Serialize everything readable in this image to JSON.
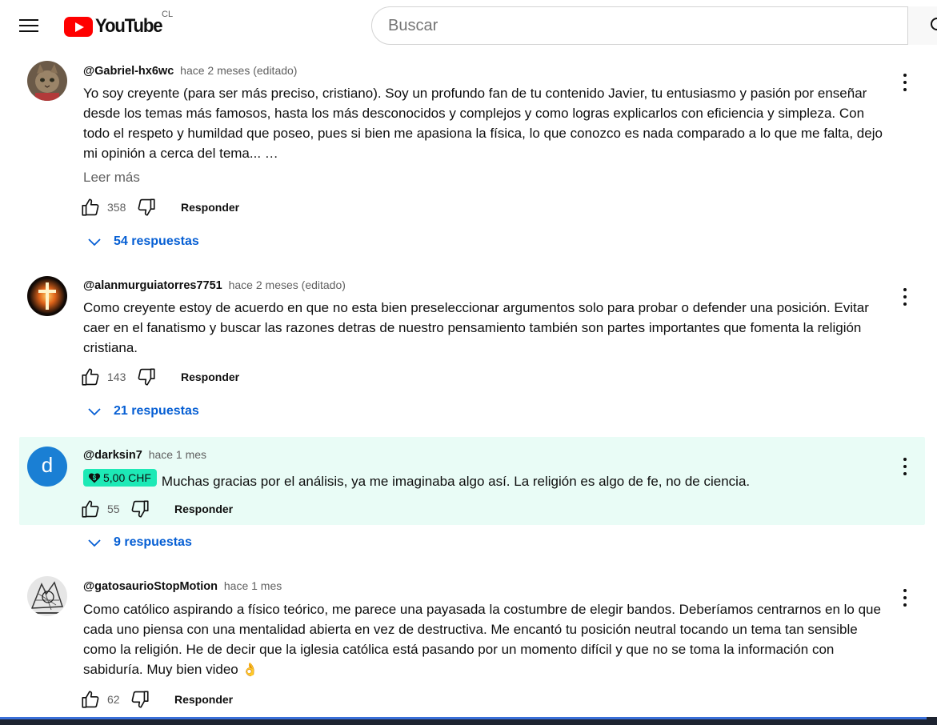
{
  "topbar": {
    "logo_text": "YouTube",
    "country_code": "CL",
    "search_placeholder": "Buscar"
  },
  "colors": {
    "brand_red": "#ff0000",
    "link_blue": "#065fd4",
    "highlight_bg": "#e9fcf6",
    "super_thanks_chip": "#1de9b6"
  },
  "comments": [
    {
      "author": "@Gabriel-hx6wc",
      "time": "hace 2 meses (editado)",
      "body": "Yo soy creyente (para ser más preciso, cristiano). Soy un profundo fan de tu contenido Javier, tu entusiasmo y pasión por enseñar desde los temas más famosos, hasta los más desconocidos y complejos y como logras explicarlos con eficiencia y simpleza. Con todo el respeto y humildad que poseo, pues si bien me apasiona la física, lo que conozco es nada comparado a lo que me falta, dejo mi opinión a cerca del tema... …",
      "read_more": "Leer más",
      "likes": "358",
      "reply_label": "Responder",
      "replies": "54 respuestas",
      "avatar": "cat-photo-avatar"
    },
    {
      "author": "@alanmurguiatorres7751",
      "time": "hace 2 meses (editado)",
      "body": "Como creyente estoy de acuerdo en que no esta bien preseleccionar argumentos solo para probar o defender una posición. Evitar caer en el fanatismo y buscar las razones detras de nuestro pensamiento también son partes importantes que fomenta la religión cristiana.",
      "likes": "143",
      "reply_label": "Responder",
      "replies": "21 respuestas",
      "avatar": "glowing-cross-avatar"
    },
    {
      "author": "@darksin7",
      "time": "hace 1 mes",
      "super_thanks": "5,00 CHF",
      "body": "Muchas gracias por el análisis, ya me imaginaba algo así. La religión es algo de fe, no de ciencia.",
      "likes": "55",
      "reply_label": "Responder",
      "replies": "9 respuestas",
      "avatar_letter": "d",
      "avatar_color": "#1a7fd4"
    },
    {
      "author": "@gatosaurioStopMotion",
      "time": "hace 1 mes",
      "body": "Como católico aspirando a físico teórico, me parece una payasada la costumbre de elegir bandos. Deberíamos centrarnos en lo que cada uno piensa con una mentalidad abierta en vez de destructiva. Me encantó tu posición neutral tocando un tema tan sensible como la religión. He de decir que la iglesia católica está pasando por un momento difícil y que no se toma la información con sabiduría. Muy bien video",
      "emoji": "👌",
      "likes": "62",
      "reply_label": "Responder",
      "avatar": "sketch-drawing-avatar"
    }
  ]
}
